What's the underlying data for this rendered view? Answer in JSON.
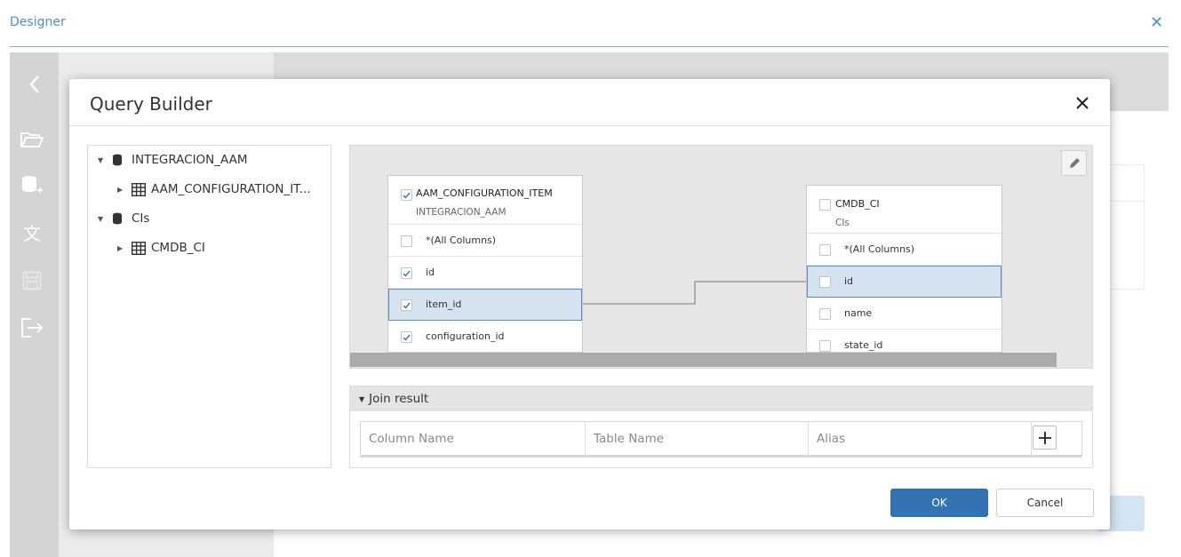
{
  "designer": {
    "title": "Designer"
  },
  "dialog": {
    "title": "Query Builder",
    "ok_label": "OK",
    "cancel_label": "Cancel"
  },
  "tree": {
    "nodes": [
      {
        "label": "INTEGRACION_AAM",
        "type": "database",
        "expanded": true,
        "children": [
          {
            "label": "AAM_CONFIGURATION_IT...",
            "type": "table"
          }
        ]
      },
      {
        "label": "CIs",
        "type": "database",
        "expanded": true,
        "children": [
          {
            "label": "CMDB_CI",
            "type": "table"
          }
        ]
      }
    ]
  },
  "diagram": {
    "tables": [
      {
        "name": "AAM_CONFIGURATION_ITEM",
        "schema": "INTEGRACION_AAM",
        "checked": true,
        "columns": [
          {
            "label": "*(All Columns)",
            "checked": false,
            "selected": false
          },
          {
            "label": "id",
            "checked": true,
            "selected": false
          },
          {
            "label": "item_id",
            "checked": true,
            "selected": true
          },
          {
            "label": "configuration_id",
            "checked": true,
            "selected": false
          }
        ]
      },
      {
        "name": "CMDB_CI",
        "schema": "CIs",
        "checked": false,
        "columns": [
          {
            "label": "*(All Columns)",
            "checked": false,
            "selected": false
          },
          {
            "label": "id",
            "checked": false,
            "selected": true
          },
          {
            "label": "name",
            "checked": false,
            "selected": false
          },
          {
            "label": "state_id",
            "checked": false,
            "selected": false
          }
        ]
      }
    ],
    "join": {
      "from": "AAM_CONFIGURATION_ITEM.item_id",
      "to": "CMDB_CI.id"
    }
  },
  "join_result": {
    "title": "Join result",
    "headers": [
      "Column Name",
      "Table Name",
      "Alias"
    ]
  },
  "colors": {
    "accent": "#3272b3",
    "link": "#4a90c9",
    "selection": "#d5e3f0"
  }
}
